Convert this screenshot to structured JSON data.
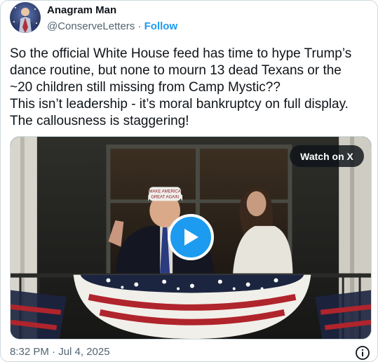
{
  "author": {
    "name": "Anagram Man",
    "handle": "@ConserveLetters",
    "separator": " · ",
    "follow_label": "Follow",
    "avatar_icon": "avatar-illustration"
  },
  "tweet": {
    "lines": [
      "So the official White House feed has time to hype Trump’s",
      "dance routine, but none to mourn 13 dead Texans or the",
      "~20 children still missing from Camp Mystic??",
      "This isn’t leadership - it’s moral bankruptcy on full display.",
      "The callousness is staggering!"
    ]
  },
  "media": {
    "watch_label": "Watch on X",
    "play_icon": "play-icon",
    "hat_text": [
      "MAKE AMERICA",
      "GREAT AGAIN"
    ]
  },
  "footer": {
    "timestamp": "8:32 PM · Jul 4, 2025",
    "info_icon": "info-icon"
  },
  "colors": {
    "accent": "#1d9bf0",
    "text_primary": "#0f1419",
    "text_secondary": "#536471",
    "bunting_red": "#b0242c",
    "bunting_navy": "#1c2540"
  }
}
